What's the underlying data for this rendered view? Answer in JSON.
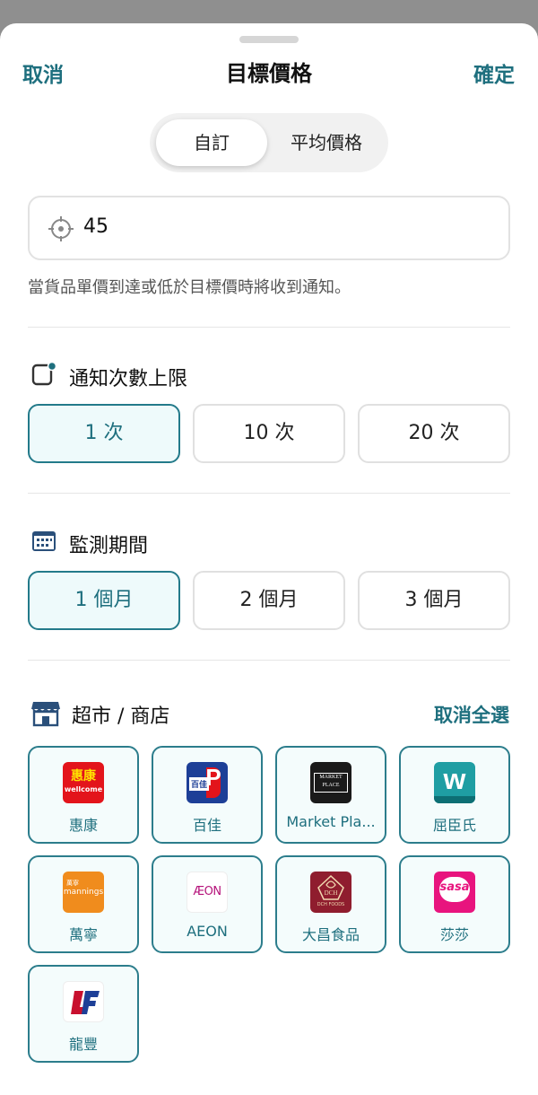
{
  "header": {
    "cancel": "取消",
    "title": "目標價格",
    "confirm": "確定"
  },
  "segment": {
    "custom": "自訂",
    "average": "平均價格",
    "selected": "自訂"
  },
  "price": {
    "value": "45"
  },
  "hint": "當貨品單價到達或低於目標價時將收到通知。",
  "notify_limit": {
    "title": "通知次數上限",
    "options": [
      "1 次",
      "10 次",
      "20 次"
    ],
    "selected": "1 次"
  },
  "period": {
    "title": "監測期間",
    "options": [
      "1 個月",
      "2 個月",
      "3 個月"
    ],
    "selected": "1 個月"
  },
  "stores": {
    "title": "超市 / 商店",
    "deselect_all": "取消全選",
    "items": [
      {
        "name": "惠康",
        "logo_text": "惠康",
        "logo_sub": "wellcome",
        "color": "#e3141b"
      },
      {
        "name": "百佳",
        "logo_text": "百佳",
        "logo_sub": "P",
        "color": "#1d3f97"
      },
      {
        "name": "Market Pla...",
        "logo_text": "MARKET",
        "logo_sub": "PLACE",
        "color": "#1a1a1a"
      },
      {
        "name": "屈臣氏",
        "logo_text": "w",
        "logo_sub": "",
        "color": "#1f9ea3"
      },
      {
        "name": "萬寧",
        "logo_text": "萬寧",
        "logo_sub": "mannings",
        "color": "#f08c1d"
      },
      {
        "name": "AEON",
        "logo_text": "ÆON",
        "logo_sub": "",
        "color": "#b5127a"
      },
      {
        "name": "大昌食品",
        "logo_text": "DCH",
        "logo_sub": "DCH FOODS",
        "color": "#8f1d2e"
      },
      {
        "name": "莎莎",
        "logo_text": "sasa",
        "logo_sub": "",
        "color": "#e8147e"
      },
      {
        "name": "龍豐",
        "logo_text": "LF",
        "logo_sub": "",
        "color": "#c8102e"
      }
    ]
  }
}
